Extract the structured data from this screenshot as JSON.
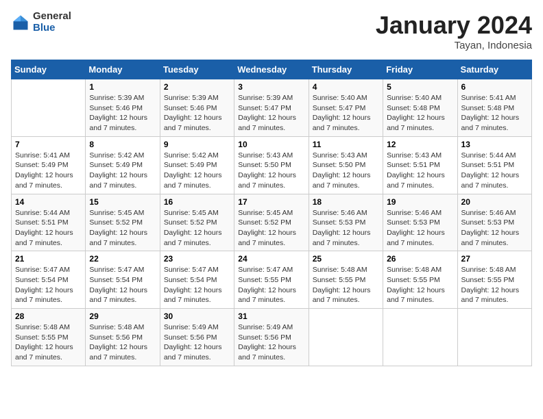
{
  "logo": {
    "general": "General",
    "blue": "Blue"
  },
  "title": "January 2024",
  "subtitle": "Tayan, Indonesia",
  "days_of_week": [
    "Sunday",
    "Monday",
    "Tuesday",
    "Wednesday",
    "Thursday",
    "Friday",
    "Saturday"
  ],
  "weeks": [
    [
      {
        "day": "",
        "detail": ""
      },
      {
        "day": "1",
        "detail": "Sunrise: 5:39 AM\nSunset: 5:46 PM\nDaylight: 12 hours\nand 7 minutes."
      },
      {
        "day": "2",
        "detail": "Sunrise: 5:39 AM\nSunset: 5:46 PM\nDaylight: 12 hours\nand 7 minutes."
      },
      {
        "day": "3",
        "detail": "Sunrise: 5:39 AM\nSunset: 5:47 PM\nDaylight: 12 hours\nand 7 minutes."
      },
      {
        "day": "4",
        "detail": "Sunrise: 5:40 AM\nSunset: 5:47 PM\nDaylight: 12 hours\nand 7 minutes."
      },
      {
        "day": "5",
        "detail": "Sunrise: 5:40 AM\nSunset: 5:48 PM\nDaylight: 12 hours\nand 7 minutes."
      },
      {
        "day": "6",
        "detail": "Sunrise: 5:41 AM\nSunset: 5:48 PM\nDaylight: 12 hours\nand 7 minutes."
      }
    ],
    [
      {
        "day": "7",
        "detail": "Sunrise: 5:41 AM\nSunset: 5:49 PM\nDaylight: 12 hours\nand 7 minutes."
      },
      {
        "day": "8",
        "detail": "Sunrise: 5:42 AM\nSunset: 5:49 PM\nDaylight: 12 hours\nand 7 minutes."
      },
      {
        "day": "9",
        "detail": "Sunrise: 5:42 AM\nSunset: 5:49 PM\nDaylight: 12 hours\nand 7 minutes."
      },
      {
        "day": "10",
        "detail": "Sunrise: 5:43 AM\nSunset: 5:50 PM\nDaylight: 12 hours\nand 7 minutes."
      },
      {
        "day": "11",
        "detail": "Sunrise: 5:43 AM\nSunset: 5:50 PM\nDaylight: 12 hours\nand 7 minutes."
      },
      {
        "day": "12",
        "detail": "Sunrise: 5:43 AM\nSunset: 5:51 PM\nDaylight: 12 hours\nand 7 minutes."
      },
      {
        "day": "13",
        "detail": "Sunrise: 5:44 AM\nSunset: 5:51 PM\nDaylight: 12 hours\nand 7 minutes."
      }
    ],
    [
      {
        "day": "14",
        "detail": "Sunrise: 5:44 AM\nSunset: 5:51 PM\nDaylight: 12 hours\nand 7 minutes."
      },
      {
        "day": "15",
        "detail": "Sunrise: 5:45 AM\nSunset: 5:52 PM\nDaylight: 12 hours\nand 7 minutes."
      },
      {
        "day": "16",
        "detail": "Sunrise: 5:45 AM\nSunset: 5:52 PM\nDaylight: 12 hours\nand 7 minutes."
      },
      {
        "day": "17",
        "detail": "Sunrise: 5:45 AM\nSunset: 5:52 PM\nDaylight: 12 hours\nand 7 minutes."
      },
      {
        "day": "18",
        "detail": "Sunrise: 5:46 AM\nSunset: 5:53 PM\nDaylight: 12 hours\nand 7 minutes."
      },
      {
        "day": "19",
        "detail": "Sunrise: 5:46 AM\nSunset: 5:53 PM\nDaylight: 12 hours\nand 7 minutes."
      },
      {
        "day": "20",
        "detail": "Sunrise: 5:46 AM\nSunset: 5:53 PM\nDaylight: 12 hours\nand 7 minutes."
      }
    ],
    [
      {
        "day": "21",
        "detail": "Sunrise: 5:47 AM\nSunset: 5:54 PM\nDaylight: 12 hours\nand 7 minutes."
      },
      {
        "day": "22",
        "detail": "Sunrise: 5:47 AM\nSunset: 5:54 PM\nDaylight: 12 hours\nand 7 minutes."
      },
      {
        "day": "23",
        "detail": "Sunrise: 5:47 AM\nSunset: 5:54 PM\nDaylight: 12 hours\nand 7 minutes."
      },
      {
        "day": "24",
        "detail": "Sunrise: 5:47 AM\nSunset: 5:55 PM\nDaylight: 12 hours\nand 7 minutes."
      },
      {
        "day": "25",
        "detail": "Sunrise: 5:48 AM\nSunset: 5:55 PM\nDaylight: 12 hours\nand 7 minutes."
      },
      {
        "day": "26",
        "detail": "Sunrise: 5:48 AM\nSunset: 5:55 PM\nDaylight: 12 hours\nand 7 minutes."
      },
      {
        "day": "27",
        "detail": "Sunrise: 5:48 AM\nSunset: 5:55 PM\nDaylight: 12 hours\nand 7 minutes."
      }
    ],
    [
      {
        "day": "28",
        "detail": "Sunrise: 5:48 AM\nSunset: 5:55 PM\nDaylight: 12 hours\nand 7 minutes."
      },
      {
        "day": "29",
        "detail": "Sunrise: 5:48 AM\nSunset: 5:56 PM\nDaylight: 12 hours\nand 7 minutes."
      },
      {
        "day": "30",
        "detail": "Sunrise: 5:49 AM\nSunset: 5:56 PM\nDaylight: 12 hours\nand 7 minutes."
      },
      {
        "day": "31",
        "detail": "Sunrise: 5:49 AM\nSunset: 5:56 PM\nDaylight: 12 hours\nand 7 minutes."
      },
      {
        "day": "",
        "detail": ""
      },
      {
        "day": "",
        "detail": ""
      },
      {
        "day": "",
        "detail": ""
      }
    ]
  ]
}
